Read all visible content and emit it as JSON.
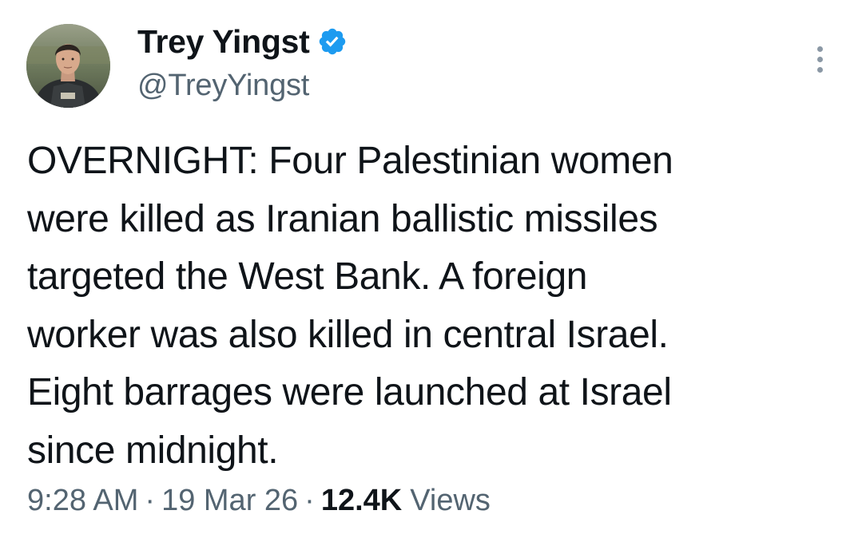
{
  "author": {
    "display_name": "Trey Yingst",
    "handle": "@TreyYingst",
    "verified_icon": "verified-badge-icon"
  },
  "tweet": {
    "text": "OVERNIGHT: Four Palestinian women\nwere killed as Iranian ballistic missiles\ntargeted the West Bank. A foreign\nworker was also killed in central Israel.\nEight barrages were launched at Israel\nsince midnight."
  },
  "meta": {
    "time": "9:28 AM",
    "separator": "·",
    "date": "19 Mar 26",
    "views_count": "12.4K",
    "views_label": "Views"
  },
  "colors": {
    "verified_blue": "#1d9bf0",
    "text_primary": "#0f1419",
    "text_secondary": "#536471"
  },
  "icons": {
    "more": "more-options-icon"
  }
}
